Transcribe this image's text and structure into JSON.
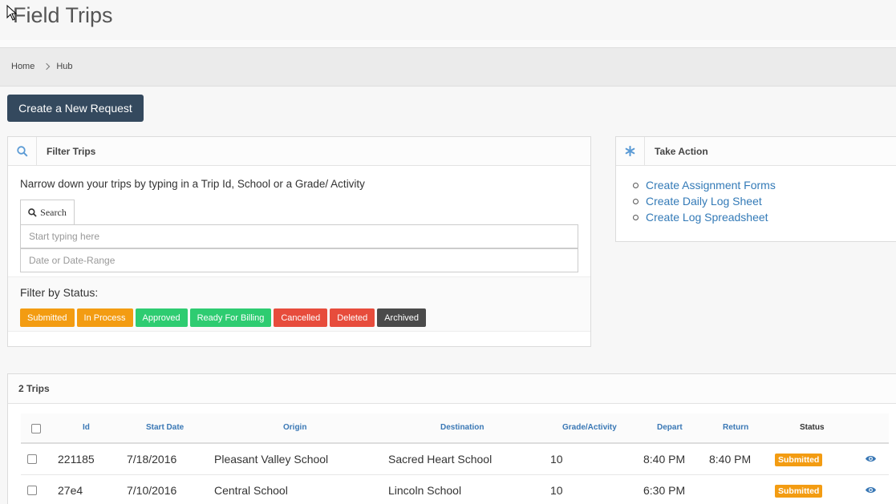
{
  "page": {
    "title": "Field Trips"
  },
  "breadcrumb": [
    "Home",
    "Hub"
  ],
  "actions": {
    "new_request": "Create a New Request"
  },
  "filter": {
    "title": "Filter Trips",
    "description": "Narrow down your trips by typing in a Trip Id, School or a Grade/ Activity",
    "search_label": "Search",
    "text_placeholder": "Start typing here",
    "date_placeholder": "Date or Date-Range",
    "status_label": "Filter by Status:",
    "statuses": [
      {
        "label": "Submitted",
        "color": "#f39c12"
      },
      {
        "label": "In Process",
        "color": "#f39c12"
      },
      {
        "label": "Approved",
        "color": "#2ecc71"
      },
      {
        "label": "Ready For Billing",
        "color": "#2ecc71"
      },
      {
        "label": "Cancelled",
        "color": "#e74c3c"
      },
      {
        "label": "Deleted",
        "color": "#e74c3c"
      },
      {
        "label": "Archived",
        "color": "#4a4a4a"
      }
    ]
  },
  "take_action": {
    "title": "Take Action",
    "links": [
      "Create Assignment Forms",
      "Create Daily Log Sheet",
      "Create Log Spreadsheet"
    ]
  },
  "trips": {
    "count_label": "2 Trips",
    "columns": [
      "Id",
      "Start Date",
      "Origin",
      "Destination",
      "Grade/Activity",
      "Depart",
      "Return",
      "Status"
    ],
    "rows": [
      {
        "id": "221185",
        "start_date": "7/18/2016",
        "origin": "Pleasant Valley School",
        "destination": "Sacred Heart School",
        "grade": "10",
        "depart": "8:40 PM",
        "return": "8:40 PM",
        "status": "Submitted"
      },
      {
        "id": "27e4",
        "start_date": "7/10/2016",
        "origin": "Central School",
        "destination": "Lincoln School",
        "grade": "10",
        "depart": "6:30 PM",
        "return": "",
        "status": "Submitted"
      }
    ]
  },
  "colors": {
    "primary_button": "#34495e",
    "link": "#337ab7",
    "status_submitted": "#f39c12"
  }
}
